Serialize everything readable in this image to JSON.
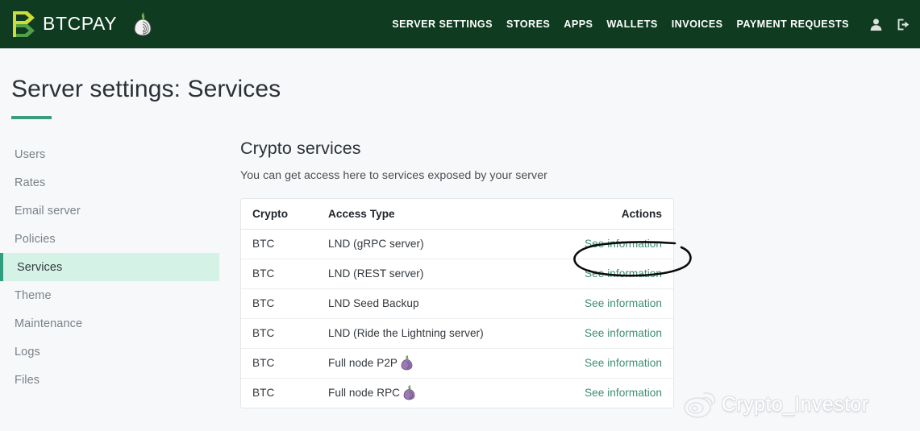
{
  "navbar": {
    "brand_text": "BTCPAY",
    "brand_logo_icon": "btcpay-logo-icon",
    "brand_onion_icon": "tor-onion-icon",
    "links": [
      {
        "label": "SERVER SETTINGS"
      },
      {
        "label": "STORES"
      },
      {
        "label": "APPS"
      },
      {
        "label": "WALLETS"
      },
      {
        "label": "INVOICES"
      },
      {
        "label": "PAYMENT REQUESTS"
      }
    ],
    "account_icon": "user-icon",
    "logout_icon": "sign-out-icon",
    "background_color": "#0f3b20"
  },
  "page": {
    "title": "Server settings: Services",
    "accent_color": "#3d9c7e"
  },
  "sidebar": {
    "items": [
      {
        "label": "Users",
        "active": false
      },
      {
        "label": "Rates",
        "active": false
      },
      {
        "label": "Email server",
        "active": false
      },
      {
        "label": "Policies",
        "active": false
      },
      {
        "label": "Services",
        "active": true
      },
      {
        "label": "Theme",
        "active": false
      },
      {
        "label": "Maintenance",
        "active": false
      },
      {
        "label": "Logs",
        "active": false
      },
      {
        "label": "Files",
        "active": false
      }
    ],
    "active_bg_color": "#d5f2e6",
    "active_border_color": "#2e9e7e"
  },
  "main": {
    "heading": "Crypto services",
    "subheading": "You can get access here to services exposed by your server",
    "table": {
      "columns": [
        "Crypto",
        "Access Type",
        "Actions"
      ],
      "link_color": "#3e8d73",
      "rows": [
        {
          "crypto": "BTC",
          "access_type": "LND (gRPC server)",
          "tor": false,
          "action": "See information"
        },
        {
          "crypto": "BTC",
          "access_type": "LND (REST server)",
          "tor": false,
          "action": "See information"
        },
        {
          "crypto": "BTC",
          "access_type": "LND Seed Backup",
          "tor": false,
          "action": "See information"
        },
        {
          "crypto": "BTC",
          "access_type": "LND (Ride the Lightning server)",
          "tor": false,
          "action": "See information"
        },
        {
          "crypto": "BTC",
          "access_type": "Full node P2P",
          "tor": true,
          "action": "See information"
        },
        {
          "crypto": "BTC",
          "access_type": "Full node RPC",
          "tor": true,
          "action": "See information"
        }
      ]
    }
  },
  "annotation": {
    "shape": "hand-drawn-ellipse",
    "target": "See information",
    "color": "#000000"
  },
  "watermark": {
    "text": "Crypto_Investor",
    "icon": "weibo-icon"
  }
}
